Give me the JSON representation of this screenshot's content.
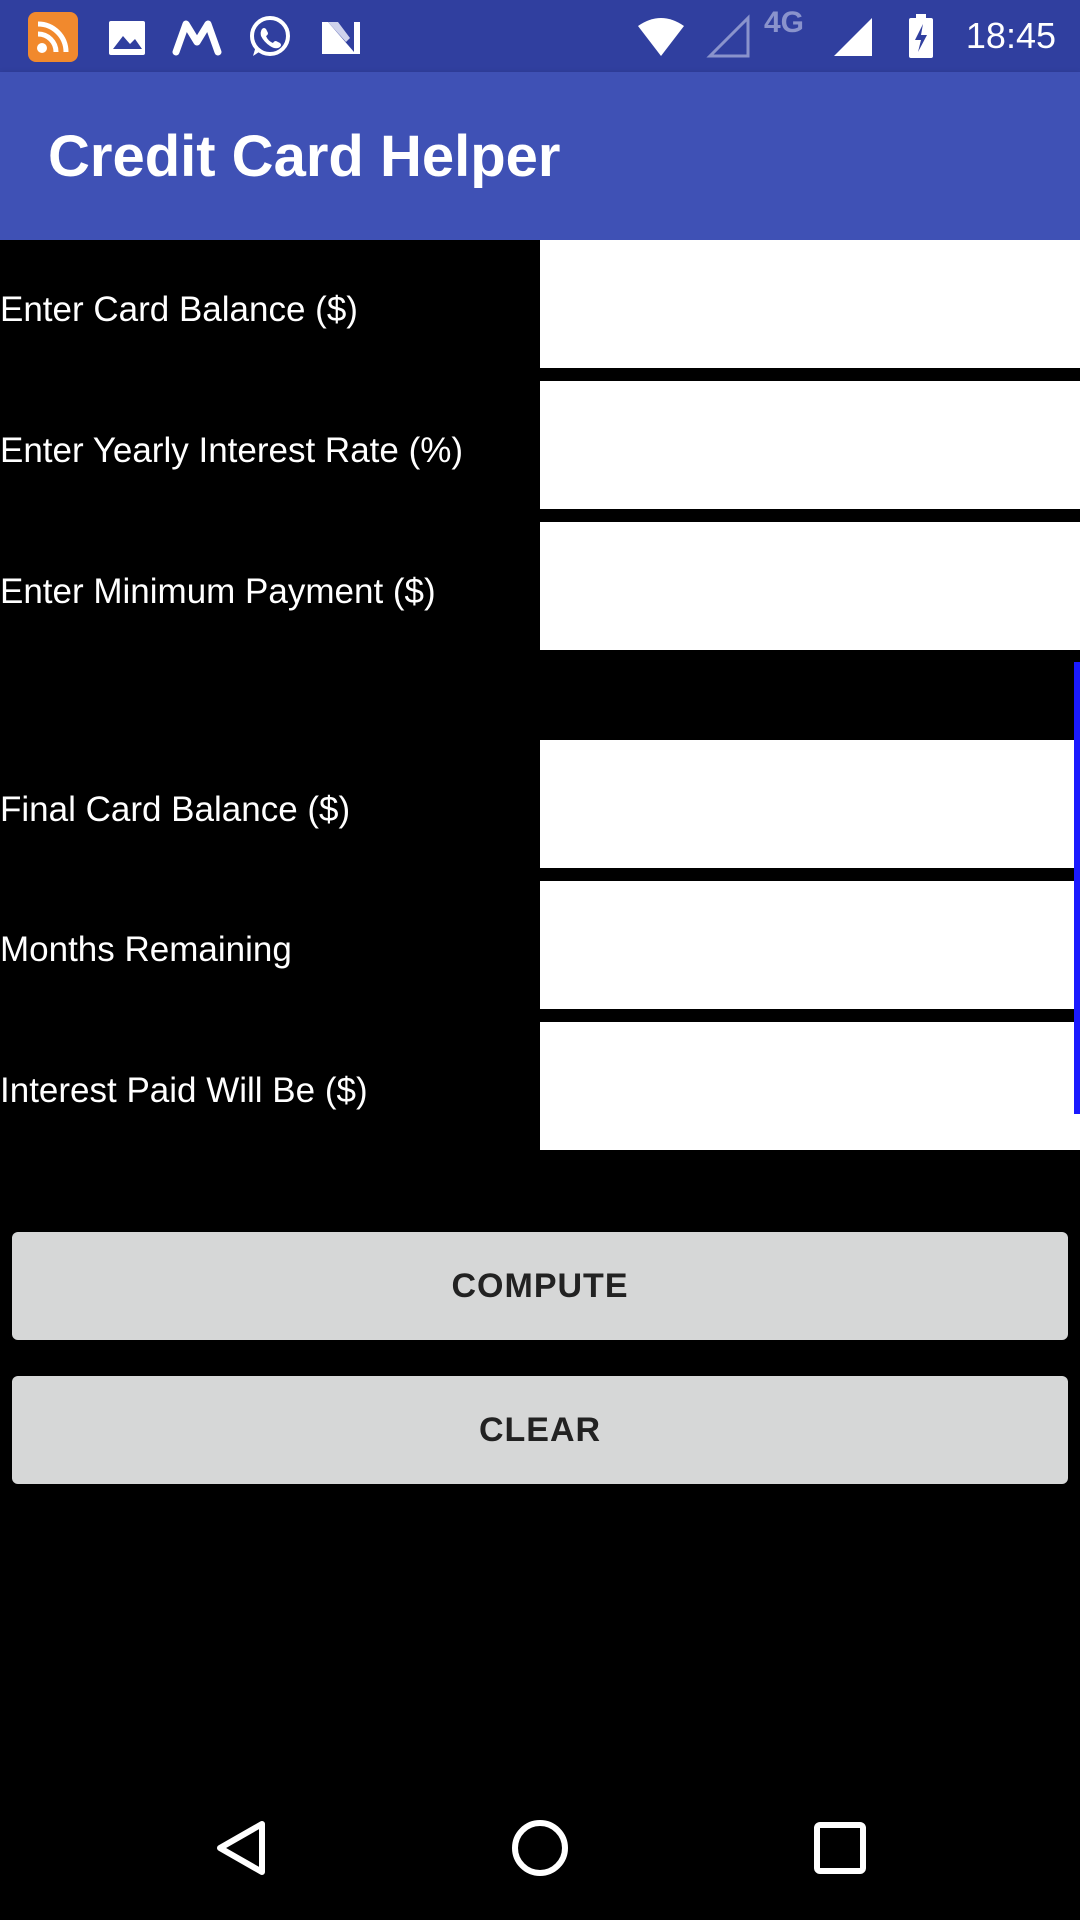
{
  "status_bar": {
    "time": "18:45",
    "network_label": "4G",
    "notification_icons": [
      "rss-feed-icon",
      "image-icon",
      "m-app-icon",
      "whatsapp-icon",
      "n-app-icon"
    ],
    "system_icons": [
      "wifi-icon",
      "signal-empty-icon",
      "signal-icon",
      "battery-charging-icon"
    ]
  },
  "app_bar": {
    "title": "Credit Card Helper"
  },
  "form": {
    "inputs": [
      {
        "label": "Enter Card Balance ($)",
        "value": ""
      },
      {
        "label": "Enter Yearly Interest Rate (%)",
        "value": ""
      },
      {
        "label": "Enter Minimum Payment ($)",
        "value": ""
      }
    ],
    "outputs": [
      {
        "label": "Final Card Balance ($)",
        "value": ""
      },
      {
        "label": "Months Remaining",
        "value": ""
      },
      {
        "label": "Interest Paid Will Be ($)",
        "value": ""
      }
    ]
  },
  "buttons": {
    "compute_label": "COMPUTE",
    "clear_label": "CLEAR"
  },
  "nav_bar": {
    "icons": [
      "back-icon",
      "home-icon",
      "recents-icon"
    ]
  },
  "colors": {
    "status_bar": "#303f9f",
    "app_bar": "#3f51b5",
    "background": "#000000",
    "field": "#ffffff",
    "button": "#d6d7d7",
    "scroll_indicator": "#1a1aff"
  }
}
